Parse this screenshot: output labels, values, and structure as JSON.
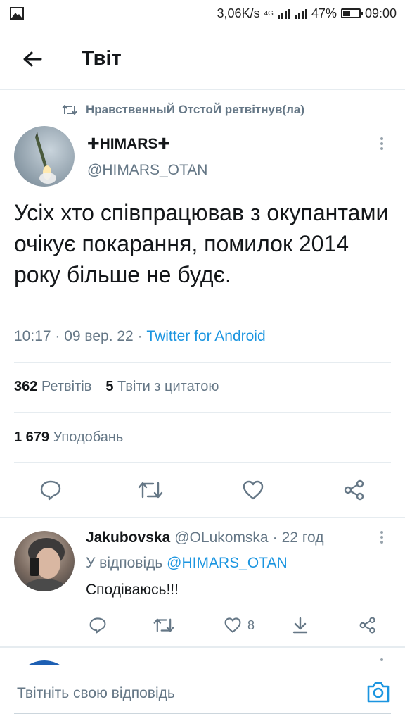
{
  "status_bar": {
    "speed": "3,06K/s",
    "network": "4G",
    "battery": "47%",
    "battery_level": 0.47,
    "time": "09:00"
  },
  "header": {
    "title": "Твіт",
    "back_icon": "arrow-left-icon"
  },
  "retweet_notice": {
    "text": "НравственныЙ ОтстоЙ ретвітнув(ла)",
    "icon": "retweet-icon"
  },
  "tweet": {
    "author_name": "✚HIMARS✚",
    "author_handle": "@HIMARS_OTAN",
    "text": "Усіх хто співпрацював з окупантами очікує покарання, помилок 2014 року більше не будє.",
    "time": "10:17",
    "date": "09 вер. 22",
    "source": "Twitter for Android",
    "retweets_count": "362",
    "retweets_label": "Ретвітів",
    "quotes_count": "5",
    "quotes_label": "Твіти з цитатою",
    "likes_count": "1 679",
    "likes_label": "Уподобань",
    "actions": [
      "reply-icon",
      "retweet-icon",
      "heart-icon",
      "share-icon"
    ]
  },
  "reply": {
    "author_name": "Jakubovska",
    "author_handle": "@OLukomska",
    "age": "22 год",
    "reply_to_label": "У відповідь",
    "reply_to_handle": "@HIMARS_OTAN",
    "text": "Сподіваюсь!!!",
    "like_count": "8",
    "actions": [
      "reply-icon",
      "retweet-icon",
      "heart-icon",
      "download-icon",
      "share-icon"
    ]
  },
  "compose": {
    "placeholder": "Твітніть свою відповідь",
    "icon": "camera-icon"
  },
  "colors": {
    "accent": "#1b95e0",
    "text": "#14171a",
    "muted": "#657786",
    "divider": "#e6ecf0"
  }
}
